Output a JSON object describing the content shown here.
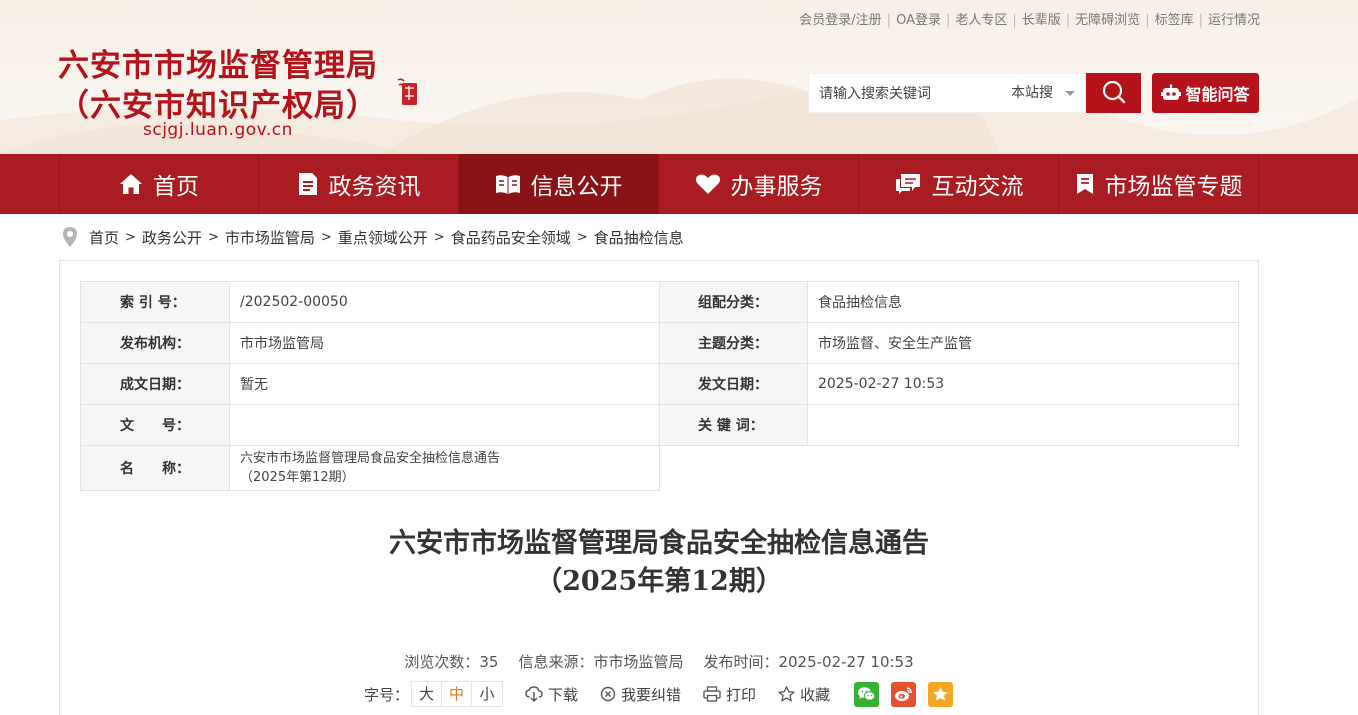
{
  "top_links": [
    "会员登录/注册",
    "OA登录",
    "老人专区",
    "长辈版",
    "无障碍浏览",
    "标签库",
    "运行情况"
  ],
  "site": {
    "title_line1": "六安市市场监督管理局",
    "title_line2": "（六安市知识产权局）",
    "domain": "scjgj.luan.gov.cn"
  },
  "search": {
    "placeholder": "请输入搜索关键词",
    "scope": "本站搜",
    "ai_label": "智能问答"
  },
  "nav": [
    {
      "label": "首页",
      "icon": "home-icon"
    },
    {
      "label": "政务资讯",
      "icon": "news-icon"
    },
    {
      "label": "信息公开",
      "icon": "open-book-icon",
      "active": true
    },
    {
      "label": "办事服务",
      "icon": "heart-icon"
    },
    {
      "label": "互动交流",
      "icon": "chat-icon"
    },
    {
      "label": "市场监管专题",
      "icon": "bookmark-icon"
    }
  ],
  "breadcrumb": [
    "首页",
    "政务公开",
    "市市场监管局",
    "重点领域公开",
    "食品药品安全领域",
    "食品抽检信息"
  ],
  "meta": {
    "index_label": "索 引 号：",
    "index_value": "/202502-00050",
    "category_label": "组配分类：",
    "category_value": "食品抽检信息",
    "publisher_label": "发布机构：",
    "publisher_value": "市市场监管局",
    "topic_label": "主题分类：",
    "topic_value": "市场监督、安全生产监管",
    "created_label": "成文日期：",
    "created_value": "暂无",
    "published_label": "发文日期：",
    "published_value": "2025-02-27 10:53",
    "docno_label": "文　　号：",
    "docno_value": "",
    "keywords_label": "关 键 词：",
    "keywords_value": "",
    "name_label": "名　　称：",
    "name_value_line1": "六安市市场监督管理局食品安全抽检信息通告",
    "name_value_line2": "（2025年第12期）"
  },
  "article": {
    "title_line1": "六安市市场监督管理局食品安全抽检信息通告",
    "title_line2": "（2025年第12期）",
    "views": "浏览次数：35",
    "source": "信息来源：市市场监管局",
    "time": "发布时间：2025-02-27 10:53"
  },
  "tools": {
    "font_label": "字号：",
    "font_large": "大",
    "font_medium": "中",
    "font_small": "小",
    "download": "下载",
    "correct": "我要纠错",
    "print": "打印",
    "favorite": "收藏"
  },
  "colors": {
    "brand_red": "#b4131b",
    "nav_red": "#a81c22",
    "nav_active": "#8a1318",
    "wechat_green": "#37b036",
    "weibo_red": "#e6502f",
    "fav_orange": "#f5a623"
  }
}
